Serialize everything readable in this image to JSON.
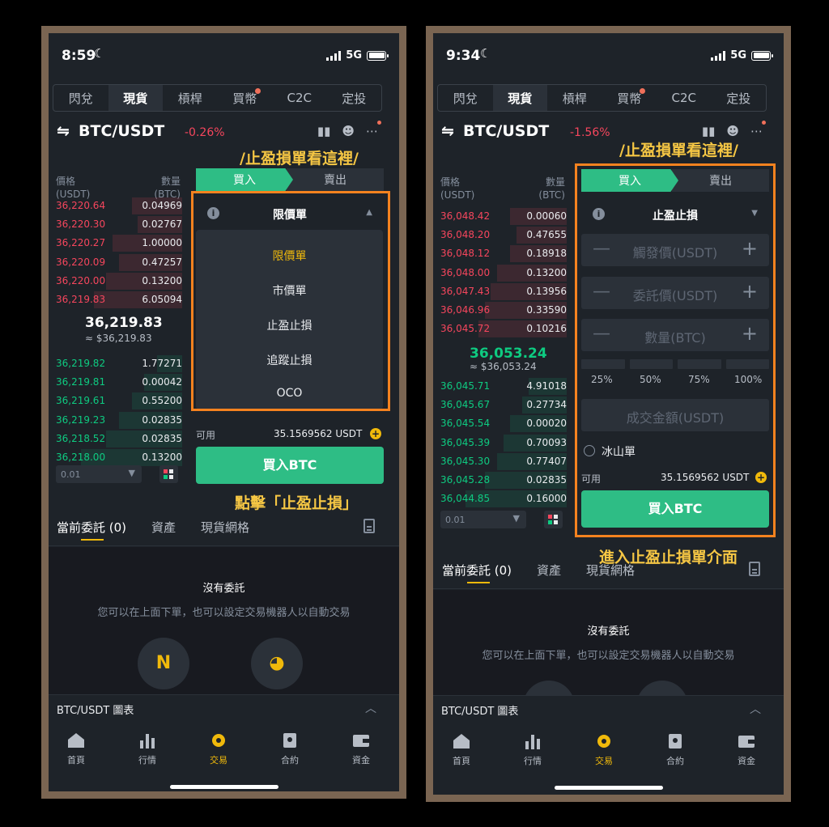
{
  "common": {
    "network": "5G",
    "nav_tabs": [
      "閃兌",
      "現貨",
      "槓桿",
      "買幣",
      "C2C",
      "定投"
    ],
    "pair": "BTC/USDT",
    "buy_tab": "買入",
    "sell_tab": "賣出",
    "ob_price_head": "價格",
    "ob_price_unit": "(USDT)",
    "ob_qty_head": "數量",
    "ob_qty_unit": "(BTC)",
    "available_label": "可用",
    "available_value": "35.1569562 USDT",
    "buy_button": "買入BTC",
    "depth_value": "0.01",
    "order_tabs": [
      "當前委託 (0)",
      "資產",
      "現貨網格"
    ],
    "no_orders": "沒有委託",
    "no_orders_hint": "您可以在上面下單，也可以設定交易機器人以自動交易",
    "chart_bar": "BTC/USDT 圖表",
    "bottom_nav": [
      "首頁",
      "行情",
      "交易",
      "合約",
      "資金"
    ],
    "annotation_top": "/止盈損單看這裡/"
  },
  "left": {
    "time": "8:59",
    "change": "-0.26%",
    "asks": [
      {
        "price": "36,220.64",
        "qty": "0.04969",
        "depth": 0.4
      },
      {
        "price": "36,220.30",
        "qty": "0.02767",
        "depth": 0.35
      },
      {
        "price": "36,220.27",
        "qty": "1.00000",
        "depth": 0.55
      },
      {
        "price": "36,220.09",
        "qty": "0.47257",
        "depth": 0.5
      },
      {
        "price": "36,220.00",
        "qty": "0.13200",
        "depth": 0.6
      },
      {
        "price": "36,219.83",
        "qty": "6.05094",
        "depth": 0.7
      }
    ],
    "last_price": "36,219.83",
    "last_fiat": "≈ $36,219.83",
    "bids": [
      {
        "price": "36,219.82",
        "qty": "1.77271",
        "depth": 0.2
      },
      {
        "price": "36,219.81",
        "qty": "0.00042",
        "depth": 0.3
      },
      {
        "price": "36,219.61",
        "qty": "0.55200",
        "depth": 0.4
      },
      {
        "price": "36,219.23",
        "qty": "0.02835",
        "depth": 0.5
      },
      {
        "price": "36,218.52",
        "qty": "0.02835",
        "depth": 0.6
      },
      {
        "price": "36,218.00",
        "qty": "0.13200",
        "depth": 0.8
      }
    ],
    "order_type": "限價單",
    "dropdown_options": [
      "限價單",
      "市價單",
      "止盈止損",
      "追蹤止損",
      "OCO"
    ],
    "annotation_bottom": "點擊「止盈止損」"
  },
  "right": {
    "time": "9:34",
    "change": "-1.56%",
    "asks": [
      {
        "price": "36,048.42",
        "qty": "0.00060",
        "depth": 0.45
      },
      {
        "price": "36,048.20",
        "qty": "0.47655",
        "depth": 0.4
      },
      {
        "price": "36,048.12",
        "qty": "0.18918",
        "depth": 0.45
      },
      {
        "price": "36,048.00",
        "qty": "0.13200",
        "depth": 0.55
      },
      {
        "price": "36,047.43",
        "qty": "0.13956",
        "depth": 0.6
      },
      {
        "price": "36,046.96",
        "qty": "0.33590",
        "depth": 0.65
      },
      {
        "price": "36,045.72",
        "qty": "0.10216",
        "depth": 0.7
      }
    ],
    "last_price": "36,053.24",
    "last_fiat": "≈ $36,053.24",
    "bids": [
      {
        "price": "36,045.71",
        "qty": "4.91018",
        "depth": 0.3
      },
      {
        "price": "36,045.67",
        "qty": "0.27734",
        "depth": 0.35
      },
      {
        "price": "36,045.54",
        "qty": "0.00020",
        "depth": 0.45
      },
      {
        "price": "36,045.39",
        "qty": "0.70093",
        "depth": 0.5
      },
      {
        "price": "36,045.30",
        "qty": "0.77407",
        "depth": 0.55
      },
      {
        "price": "36,045.28",
        "qty": "0.02835",
        "depth": 0.65
      },
      {
        "price": "36,044.85",
        "qty": "0.16000",
        "depth": 0.8
      }
    ],
    "order_type": "止盈止損",
    "trigger_placeholder": "觸發價(USDT)",
    "limit_placeholder": "委託價(USDT)",
    "amount_placeholder": "數量(BTC)",
    "percents": [
      "25%",
      "50%",
      "75%",
      "100%"
    ],
    "total_placeholder": "成交金額(USDT)",
    "iceberg": "冰山單",
    "annotation_bottom": "進入止盈止損單介面"
  },
  "colors": {
    "accent": "#f0b90b",
    "buy": "#2ebd85",
    "sell": "#f6465d",
    "highlight": "#f5821f",
    "annotation": "#f6c744"
  },
  "icons": [
    "moon-icon",
    "signal-icon",
    "battery-icon",
    "swap-icon",
    "candle-icon",
    "bot-icon",
    "more-icon",
    "info-icon",
    "caret-icon",
    "plus-icon",
    "document-icon",
    "home-icon",
    "markets-icon",
    "trade-icon",
    "futures-icon",
    "wallet-icon"
  ]
}
